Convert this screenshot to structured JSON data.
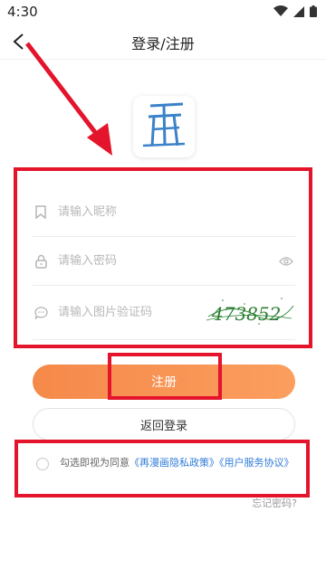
{
  "status_bar": {
    "time": "4:30"
  },
  "header": {
    "title": "登录/注册"
  },
  "logo": {
    "text": "再"
  },
  "form": {
    "nickname_placeholder": "请输入昵称",
    "password_placeholder": "请输入密码",
    "captcha_placeholder": "请输入图片验证码",
    "captcha_code": "473852"
  },
  "buttons": {
    "register": "注册",
    "back_login": "返回登录"
  },
  "agreement": {
    "prefix": "勾选即视为同意",
    "privacy": "《再漫画隐私政策》",
    "terms": "《用户服务协议》"
  },
  "forgot": "忘记密码?",
  "colors": {
    "accent": "#f5894a",
    "link": "#2f7bd8",
    "annotation": "#e3142b"
  }
}
